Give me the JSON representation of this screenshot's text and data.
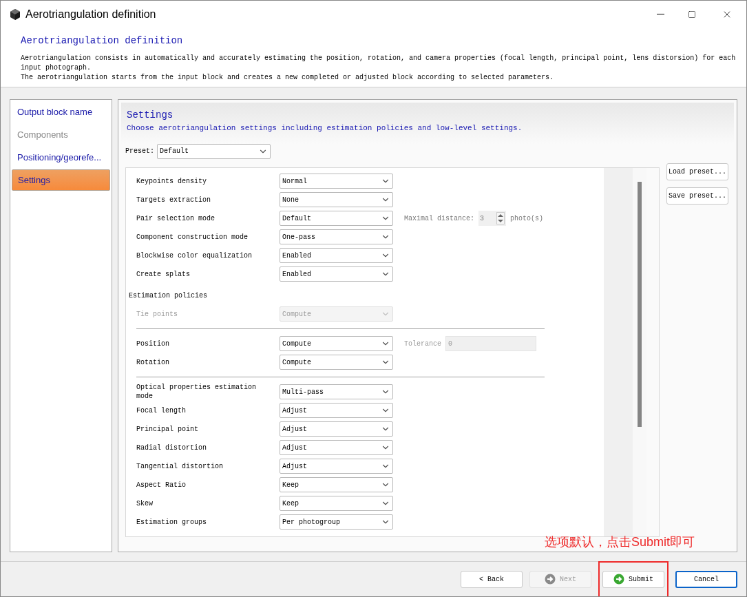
{
  "window": {
    "title": "Aerotriangulation definition"
  },
  "header": {
    "title": "Aerotriangulation definition",
    "paragraphs": [
      "Aerotriangulation consists in automatically and accurately estimating the position, rotation, and camera properties (focal length, principal point, lens distorsion) for each input photograph.",
      "The aerotriangulation starts from the input block and creates a new completed or adjusted block according to selected parameters."
    ]
  },
  "sidebar": {
    "items": [
      {
        "label": "Output block name",
        "selected": false,
        "disabled": false
      },
      {
        "label": "Components",
        "selected": false,
        "disabled": true
      },
      {
        "label": "Positioning/georefe...",
        "selected": false,
        "disabled": false
      },
      {
        "label": "Settings",
        "selected": true,
        "disabled": false
      }
    ]
  },
  "settings": {
    "title": "Settings",
    "subtitle": "Choose aerotriangulation settings including estimation policies and low-level settings.",
    "preset": {
      "label": "Preset:",
      "value": "Default"
    },
    "preset_buttons": [
      "Load preset...",
      "Save preset..."
    ],
    "rows": [
      {
        "kind": "combo",
        "label": "Keypoints density",
        "value": "Normal",
        "disabled": false
      },
      {
        "kind": "combo",
        "label": "Targets extraction",
        "value": "None",
        "disabled": false
      },
      {
        "kind": "combo",
        "label": "Pair selection mode",
        "value": "Default",
        "disabled": false,
        "extra": {
          "kind": "spin",
          "label": "Maximal distance:",
          "value": "3",
          "unit": "photo(s)"
        }
      },
      {
        "kind": "combo",
        "label": "Component construction mode",
        "value": "One-pass",
        "disabled": false
      },
      {
        "kind": "combo",
        "label": "Blockwise color equalization",
        "value": "Enabled",
        "disabled": false
      },
      {
        "kind": "combo",
        "label": "Create splats",
        "value": "Enabled",
        "disabled": false
      },
      {
        "kind": "section",
        "label": "Estimation policies"
      },
      {
        "kind": "combo",
        "label": "Tie points",
        "value": "Compute",
        "disabled": true
      },
      {
        "kind": "divider"
      },
      {
        "kind": "combo",
        "label": "Position",
        "value": "Compute",
        "disabled": false,
        "extra": {
          "kind": "text",
          "label": "Tolerance",
          "value": "0"
        }
      },
      {
        "kind": "combo",
        "label": "Rotation",
        "value": "Compute",
        "disabled": false
      },
      {
        "kind": "divider"
      },
      {
        "kind": "combo",
        "label": "Optical properties estimation mode",
        "value": "Multi-pass",
        "disabled": false
      },
      {
        "kind": "combo",
        "label": "Focal length",
        "value": "Adjust",
        "disabled": false
      },
      {
        "kind": "combo",
        "label": "Principal point",
        "value": "Adjust",
        "disabled": false
      },
      {
        "kind": "combo",
        "label": "Radial distortion",
        "value": "Adjust",
        "disabled": false
      },
      {
        "kind": "combo",
        "label": "Tangential distortion",
        "value": "Adjust",
        "disabled": false
      },
      {
        "kind": "combo",
        "label": "Aspect Ratio",
        "value": "Keep",
        "disabled": false
      },
      {
        "kind": "combo",
        "label": "Skew",
        "value": "Keep",
        "disabled": false
      },
      {
        "kind": "combo",
        "label": "Estimation groups",
        "value": "Per photogroup",
        "disabled": false
      }
    ]
  },
  "annotation": {
    "text": "选项默认，点击Submit即可"
  },
  "footer": {
    "buttons": [
      {
        "kind": "back",
        "label": "< Back",
        "disabled": false,
        "focused": false,
        "highlighted": false
      },
      {
        "kind": "next",
        "label": "Next",
        "disabled": true,
        "focused": false,
        "highlighted": false
      },
      {
        "kind": "submit",
        "label": "Submit",
        "disabled": false,
        "focused": false,
        "highlighted": true
      },
      {
        "kind": "cancel",
        "label": "Cancel",
        "disabled": false,
        "focused": true,
        "highlighted": false
      }
    ]
  }
}
